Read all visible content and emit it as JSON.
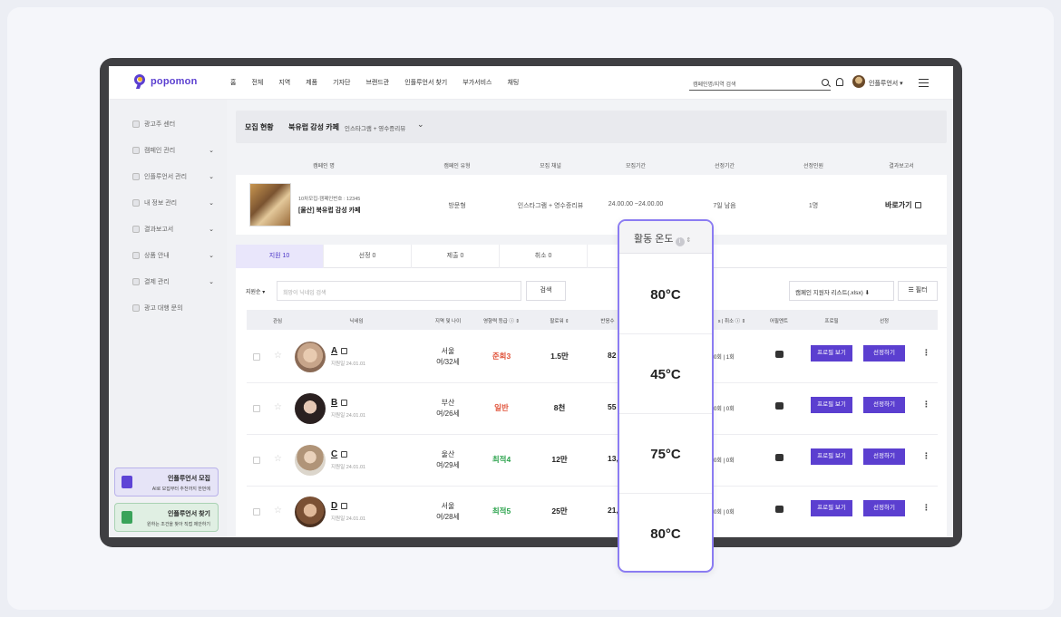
{
  "logo": "popomon",
  "nav": [
    "홈",
    "전체",
    "지역",
    "제품",
    "기자단",
    "브랜드관",
    "인플루언서 찾기",
    "부가서비스",
    "채팅"
  ],
  "search_placeholder": "캠페인명/지역 검색",
  "user_name": "인플루언서 ▾",
  "sidebar": {
    "items": [
      {
        "label": "광고주 센터",
        "chev": ""
      },
      {
        "label": "캠페인 관리",
        "chev": "⌄"
      },
      {
        "label": "인플루언서 관리",
        "chev": "⌄"
      },
      {
        "label": "내 정보 관리",
        "chev": "⌄"
      },
      {
        "label": "결과보고서",
        "chev": "⌄"
      },
      {
        "label": "상품 안내",
        "chev": "⌄"
      },
      {
        "label": "결제 관리",
        "chev": "⌄"
      },
      {
        "label": "광고 대행 문의",
        "chev": ""
      }
    ],
    "promo1": {
      "title": "인플루언서 모집",
      "sub": "AI로 모집부터 추천까지 한번에"
    },
    "promo2": {
      "title": "인플루언서 찾기",
      "sub": "원하는 조건을 찾아 직접 제안하기"
    }
  },
  "status": {
    "label": "모집 현황",
    "campaign": "북유럽 감성 카페",
    "channel": "인스타그램 + 영수증리뷰",
    "chev": "⌄"
  },
  "campaign_table": {
    "headers": [
      "캠페인 명",
      "캠페인 유형",
      "모집 채널",
      "모집기간",
      "선정기간",
      "선정인원",
      "결과보고서"
    ],
    "row": {
      "meta": "10차모집-캠페인번호 : 12345",
      "name": "[울산] 북유럽 감성 카페",
      "type": "방문형",
      "channel": "인스타그램 + 영수증리뷰",
      "period": "24.00.00 ~24.00.00",
      "select_period": "7일 남음",
      "count": "1명",
      "report": "바로가기"
    }
  },
  "tabs": [
    "지원 10",
    "선정 0",
    "제출 0",
    "취소 0"
  ],
  "filter": {
    "sort": "지원순 ▾",
    "keyword_placeholder": "희망이 닉네임 검색",
    "search_btn": "검색",
    "xlsx_btn": "캠페인 지원자 리스트(.xlsx) ⬇",
    "filter_btn": "☰ 필터"
  },
  "table_headers": [
    "관심",
    "닉네임",
    "지역 및 나이",
    "영향력 등급 ⓘ ⇕",
    "팔로워 ⇕",
    "반응수",
    "s | 취소 ⓘ ⇕",
    "어필멘트",
    "프로필",
    "선정"
  ],
  "rows": [
    {
      "name": "A",
      "date": "지원일 24.01.01",
      "region": "서울",
      "age": "여/32세",
      "grade": "준희3",
      "grade_color": "#e0533a",
      "followers": "1.5만",
      "resp": "82",
      "cnt": "0회 | 1회",
      "btn1": "프로필 보기",
      "btn2": "선정하기"
    },
    {
      "name": "B",
      "date": "지원일 24.01.01",
      "region": "부산",
      "age": "여/26세",
      "grade": "일반",
      "grade_color": "#e0533a",
      "followers": "8천",
      "resp": "55",
      "cnt": "0회 | 0회",
      "btn1": "프로필 보기",
      "btn2": "선정하기"
    },
    {
      "name": "C",
      "date": "지원일 24.01.01",
      "region": "울산",
      "age": "여/29세",
      "grade": "최적4",
      "grade_color": "#2ea44f",
      "followers": "12만",
      "resp": "13,1",
      "cnt": "0회 | 0회",
      "btn1": "프로필 보기",
      "btn2": "선정하기"
    },
    {
      "name": "D",
      "date": "지원일 24.01.01",
      "region": "서울",
      "age": "여/28세",
      "grade": "최적5",
      "grade_color": "#2ea44f",
      "followers": "25만",
      "resp": "21,3",
      "cnt": "0회 | 0회",
      "btn1": "프로필 보기",
      "btn2": "선정하기"
    }
  ],
  "overlay": {
    "header": "활동 온도",
    "values": [
      "80°C",
      "45°C",
      "75°C",
      "80°C"
    ]
  },
  "colors": {
    "accent": "#5b3fd0",
    "overlay_border": "#8b7cf2",
    "device": "#3f3f42"
  }
}
